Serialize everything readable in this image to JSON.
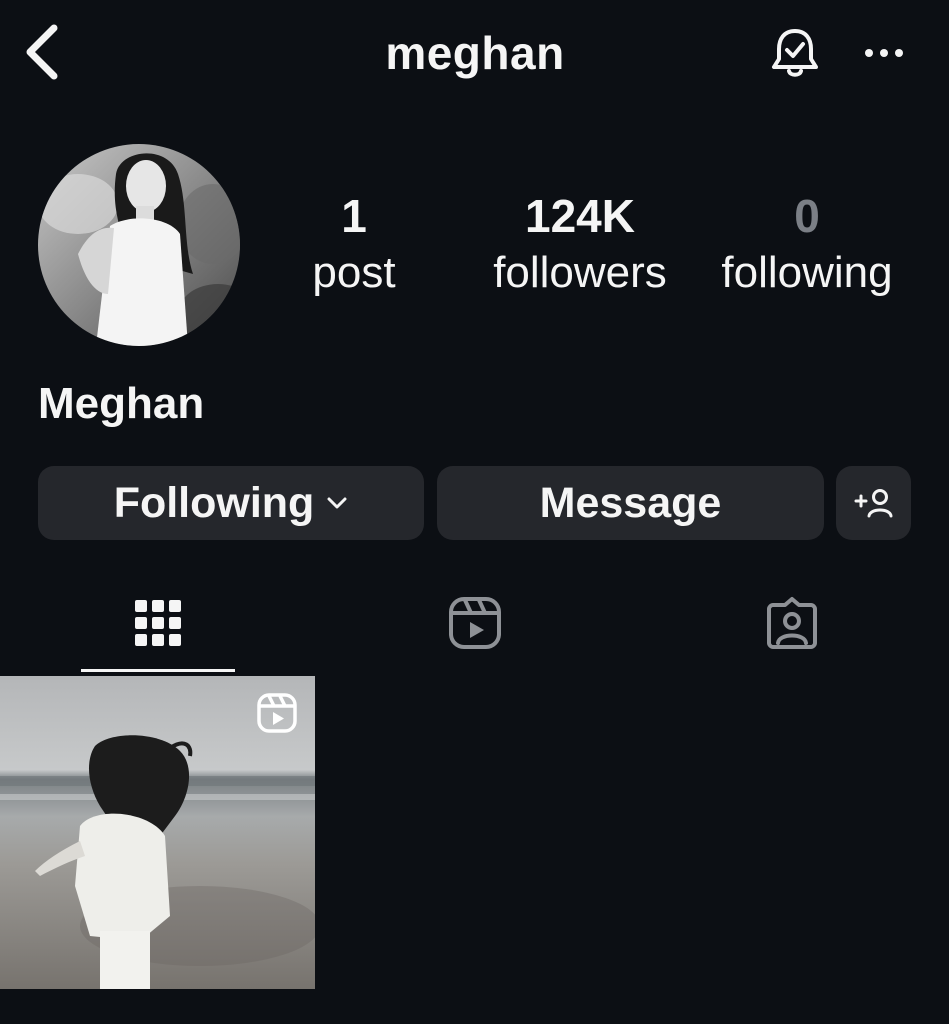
{
  "header": {
    "username": "meghan",
    "icons": {
      "back": "chevron-left-icon",
      "notifications": "bell-check-icon",
      "more": "more-horizontal-icon"
    }
  },
  "profile": {
    "display_name": "Meghan",
    "stats": {
      "posts_count": "1",
      "posts_label": "post",
      "followers_count": "124K",
      "followers_label": "followers",
      "following_count": "0",
      "following_label": "following"
    }
  },
  "actions": {
    "following_label": "Following",
    "message_label": "Message",
    "add_user_icon": "add-user-icon"
  },
  "tabs": {
    "active": "grid",
    "items": [
      "grid-icon",
      "reels-icon",
      "tagged-icon"
    ]
  },
  "posts": [
    {
      "type": "reel",
      "badge_icon": "reel-icon"
    }
  ],
  "colors": {
    "background": "#0c0f14",
    "button": "#25272c",
    "text": "#f5f5f5",
    "muted": "#7b7f86",
    "icon_inactive": "#8e9196"
  }
}
